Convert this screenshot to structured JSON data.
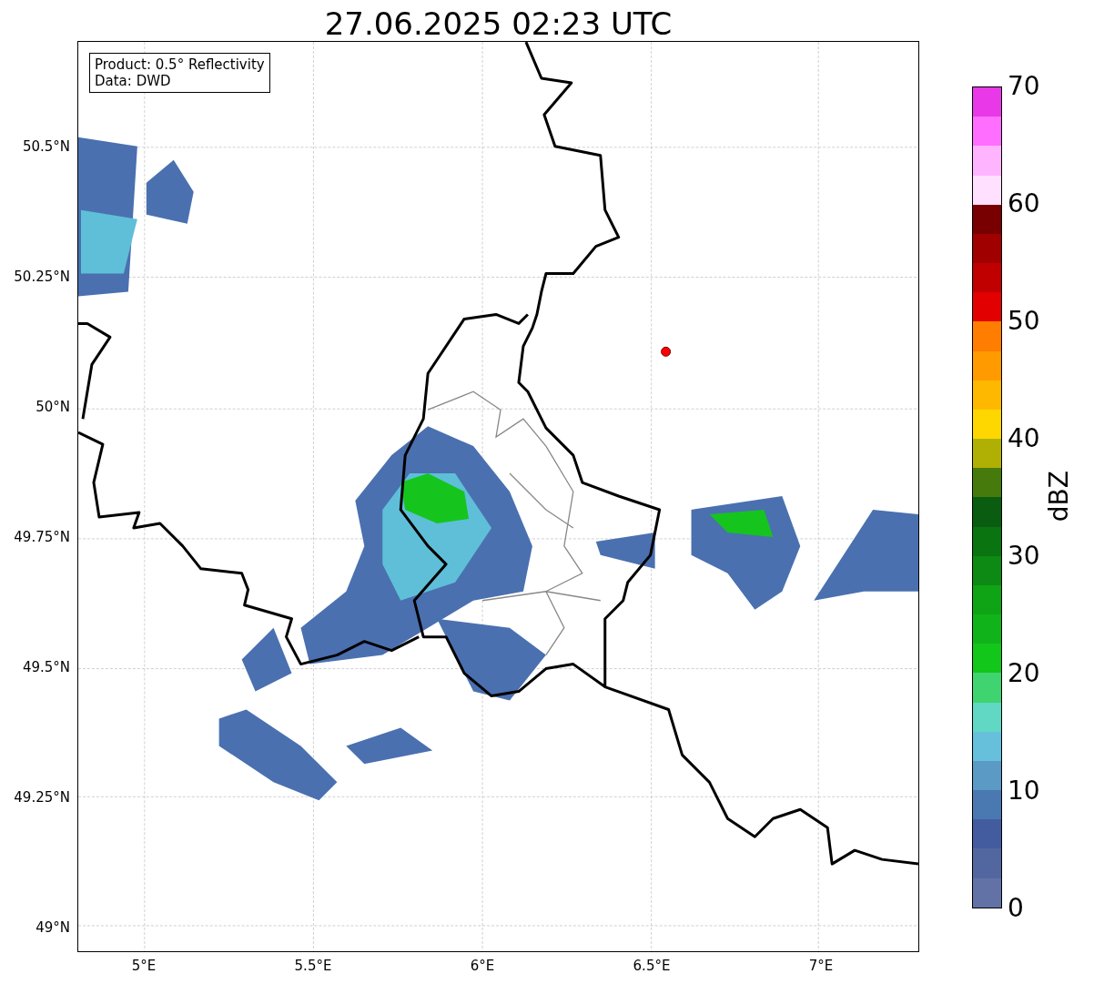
{
  "title": "27.06.2025 02:23 UTC",
  "info_box": {
    "lines": [
      "Product: 0.5° Reflectivity",
      "Data: DWD"
    ]
  },
  "map": {
    "lat_ticks": [
      "50.5°N",
      "50.25°N",
      "50°N",
      "49.75°N",
      "49.5°N",
      "49.25°N",
      "49°N"
    ],
    "lon_ticks": [
      "5°E",
      "5.5°E",
      "6°E",
      "6.5°E",
      "7°E"
    ]
  },
  "colorbar": {
    "label": "dBZ",
    "ticks": [
      "70",
      "60",
      "50",
      "40",
      "30",
      "20",
      "10",
      "0"
    ],
    "bands": [
      {
        "color": "#6272a6"
      },
      {
        "color": "#52679f"
      },
      {
        "color": "#435c9f"
      },
      {
        "color": "#4a78b0"
      },
      {
        "color": "#5a9ac4"
      },
      {
        "color": "#66c0dc"
      },
      {
        "color": "#60d8c4"
      },
      {
        "color": "#3fd470"
      },
      {
        "color": "#12c61a"
      },
      {
        "color": "#10b41a"
      },
      {
        "color": "#0fa415"
      },
      {
        "color": "#0c8a13"
      },
      {
        "color": "#0a7410"
      },
      {
        "color": "#0a5c10"
      },
      {
        "color": "#467a0c"
      },
      {
        "color": "#b0b004"
      },
      {
        "color": "#ffd700"
      },
      {
        "color": "#ffb800"
      },
      {
        "color": "#ff9a00"
      },
      {
        "color": "#ff7d00"
      },
      {
        "color": "#e20000"
      },
      {
        "color": "#c00000"
      },
      {
        "color": "#a00000"
      },
      {
        "color": "#780000"
      },
      {
        "color": "#ffe0ff"
      },
      {
        "color": "#ffb4ff"
      },
      {
        "color": "#ff6eff"
      },
      {
        "color": "#e838e8"
      }
    ]
  }
}
